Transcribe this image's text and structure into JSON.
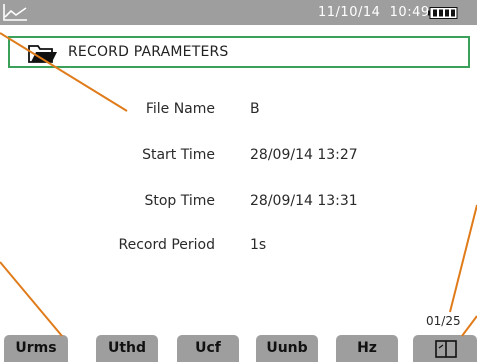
{
  "status_bar": {
    "datetime": "11/10/14  10:49",
    "icons": [
      "trend-icon",
      "battery-icon"
    ]
  },
  "title_bar": {
    "icon": "folder-icon",
    "title": "RECORD PARAMETERS"
  },
  "params": [
    {
      "label": "File Name",
      "value": "B"
    },
    {
      "label": "Start Time",
      "value": "28/09/14 13:27"
    },
    {
      "label": "Stop Time",
      "value": "28/09/14 13:31"
    },
    {
      "label": "Record Period",
      "value": "1s"
    }
  ],
  "page_counter": "01/25",
  "soft_keys": [
    {
      "label": "Urms"
    },
    {
      "label": "Uthd"
    },
    {
      "label": "Ucf"
    },
    {
      "label": "Uunb"
    },
    {
      "label": "Hz"
    },
    {
      "label": "",
      "icon": "page-select-icon"
    }
  ],
  "colors": {
    "status_bar": "#9e9e9e",
    "title_border": "#3aa05a",
    "soft_key": "#9e9e9e",
    "callout_line": "#e07b1a"
  }
}
